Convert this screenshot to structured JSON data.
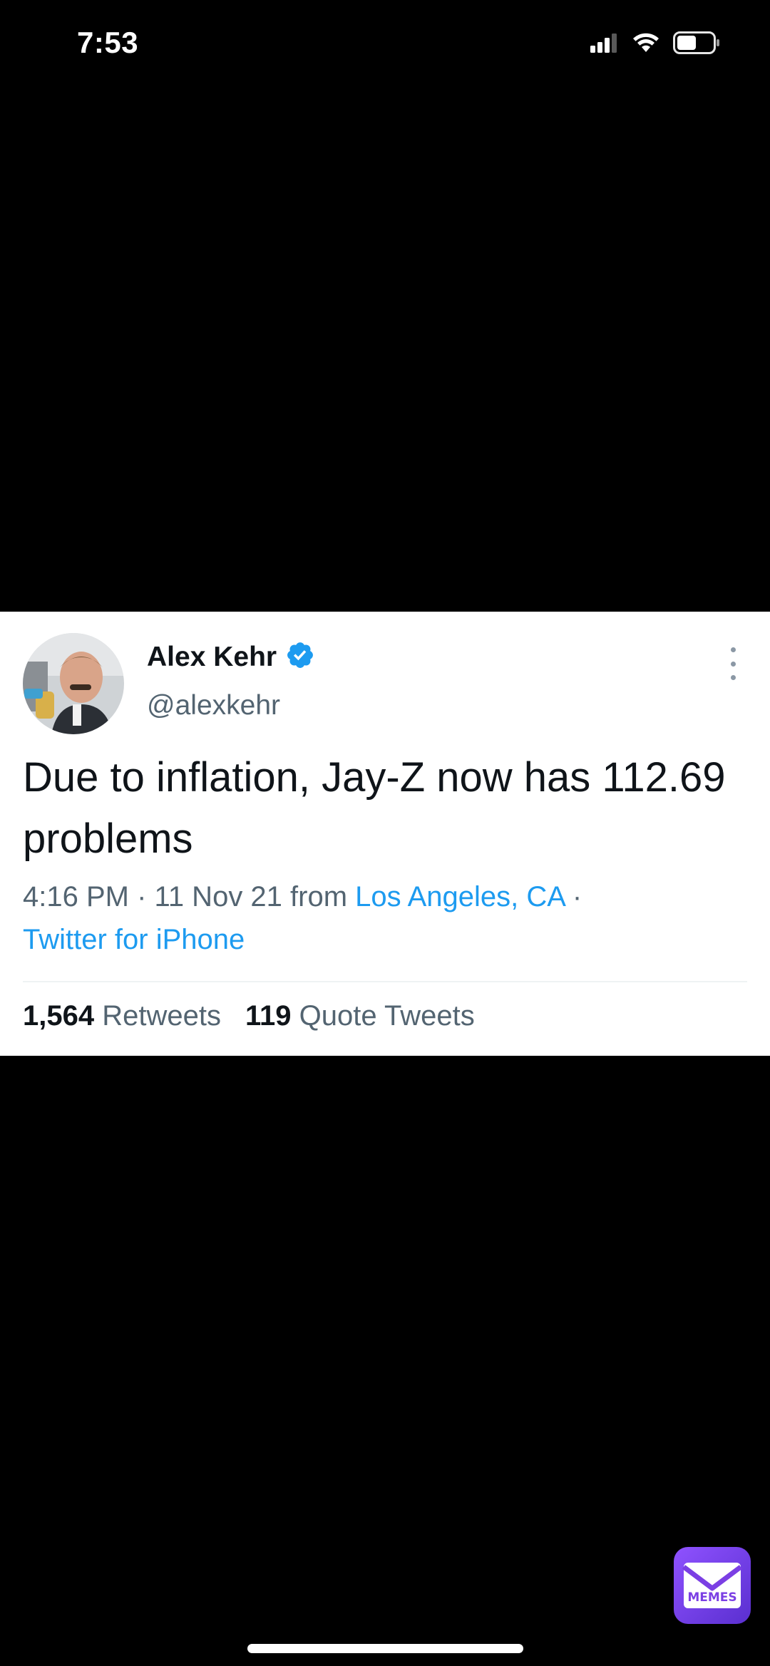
{
  "status_bar": {
    "time": "7:53",
    "signal_icon": "cellular-signal-icon",
    "wifi_icon": "wifi-icon",
    "battery_icon": "battery-icon"
  },
  "tweet": {
    "display_name": "Alex Kehr",
    "verified_icon": "verified-badge-icon",
    "handle": "@alexkehr",
    "text": "Due to inflation, Jay-Z now has 112.69 problems",
    "time": "4:16 PM",
    "separator": "·",
    "date": "11 Nov 21",
    "from_label": "from",
    "location": "Los Angeles, CA",
    "source": "Twitter for iPhone",
    "retweets_count": "1,564",
    "retweets_label": "Retweets",
    "quote_tweets_count": "119",
    "quote_tweets_label": "Quote Tweets",
    "more_icon": "more-options-icon"
  },
  "watermark": {
    "label": "MEMES",
    "icon": "memes-envelope-logo"
  },
  "colors": {
    "background": "#000000",
    "card": "#ffffff",
    "link": "#1d9bf0",
    "text_primary": "#0f1419",
    "text_secondary": "#536471",
    "verified": "#1d9bf0",
    "memes_purple": "#7b3fe4"
  }
}
